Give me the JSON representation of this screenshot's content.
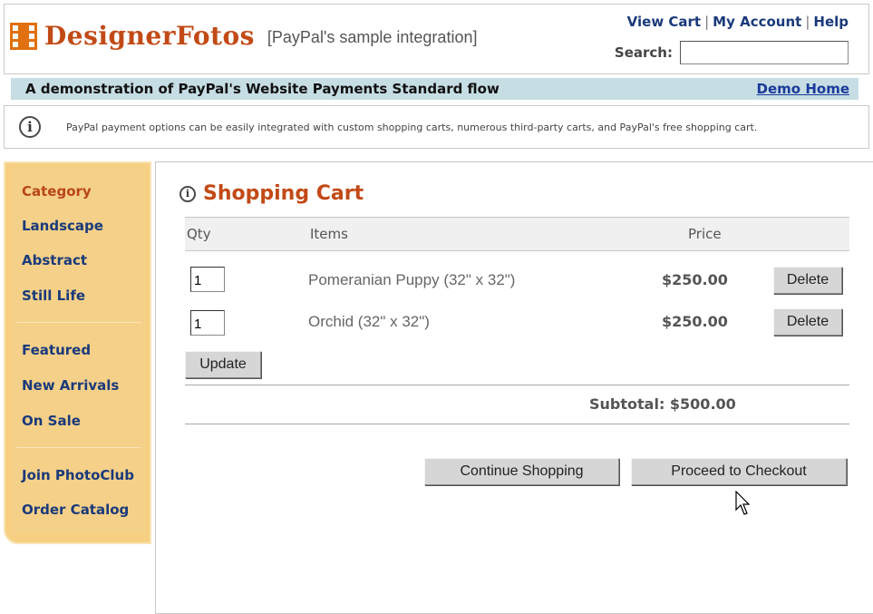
{
  "header": {
    "logo_text": "DesignerFotos",
    "logo_sub": "[PayPal's sample integration]",
    "links": [
      "View Cart",
      "My Account",
      "Help"
    ],
    "search_label": "Search:",
    "search_value": ""
  },
  "demo_bar": {
    "title": "A demonstration of PayPal's Website Payments Standard flow",
    "home_link": "Demo Home"
  },
  "info": {
    "text": "PayPal payment options can be easily integrated with custom shopping carts, numerous third-party carts, and PayPal's free shopping cart."
  },
  "sidebar": {
    "category_label": "Category",
    "categories": [
      "Landscape",
      "Abstract",
      "Still Life"
    ],
    "featured": [
      "Featured",
      "New Arrivals",
      "On Sale"
    ],
    "extras": [
      "Join PhotoClub",
      "Order Catalog"
    ]
  },
  "cart": {
    "title": "Shopping Cart",
    "columns": {
      "qty": "Qty",
      "items": "Items",
      "price": "Price"
    },
    "items": [
      {
        "qty": "1",
        "name": "Pomeranian Puppy (32\" x 32\")",
        "price": "$250.00",
        "delete_label": "Delete"
      },
      {
        "qty": "1",
        "name": "Orchid (32\" x 32\")",
        "price": "$250.00",
        "delete_label": "Delete"
      }
    ],
    "update_label": "Update",
    "subtotal": "Subtotal: $500.00",
    "continue_label": "Continue Shopping",
    "checkout_label": "Proceed to Checkout"
  },
  "colors": {
    "brand": "#c24a16",
    "link": "#1a3a7a",
    "sidebar_bg": "#f5d089",
    "demo_bar_bg": "#c6dde4"
  }
}
